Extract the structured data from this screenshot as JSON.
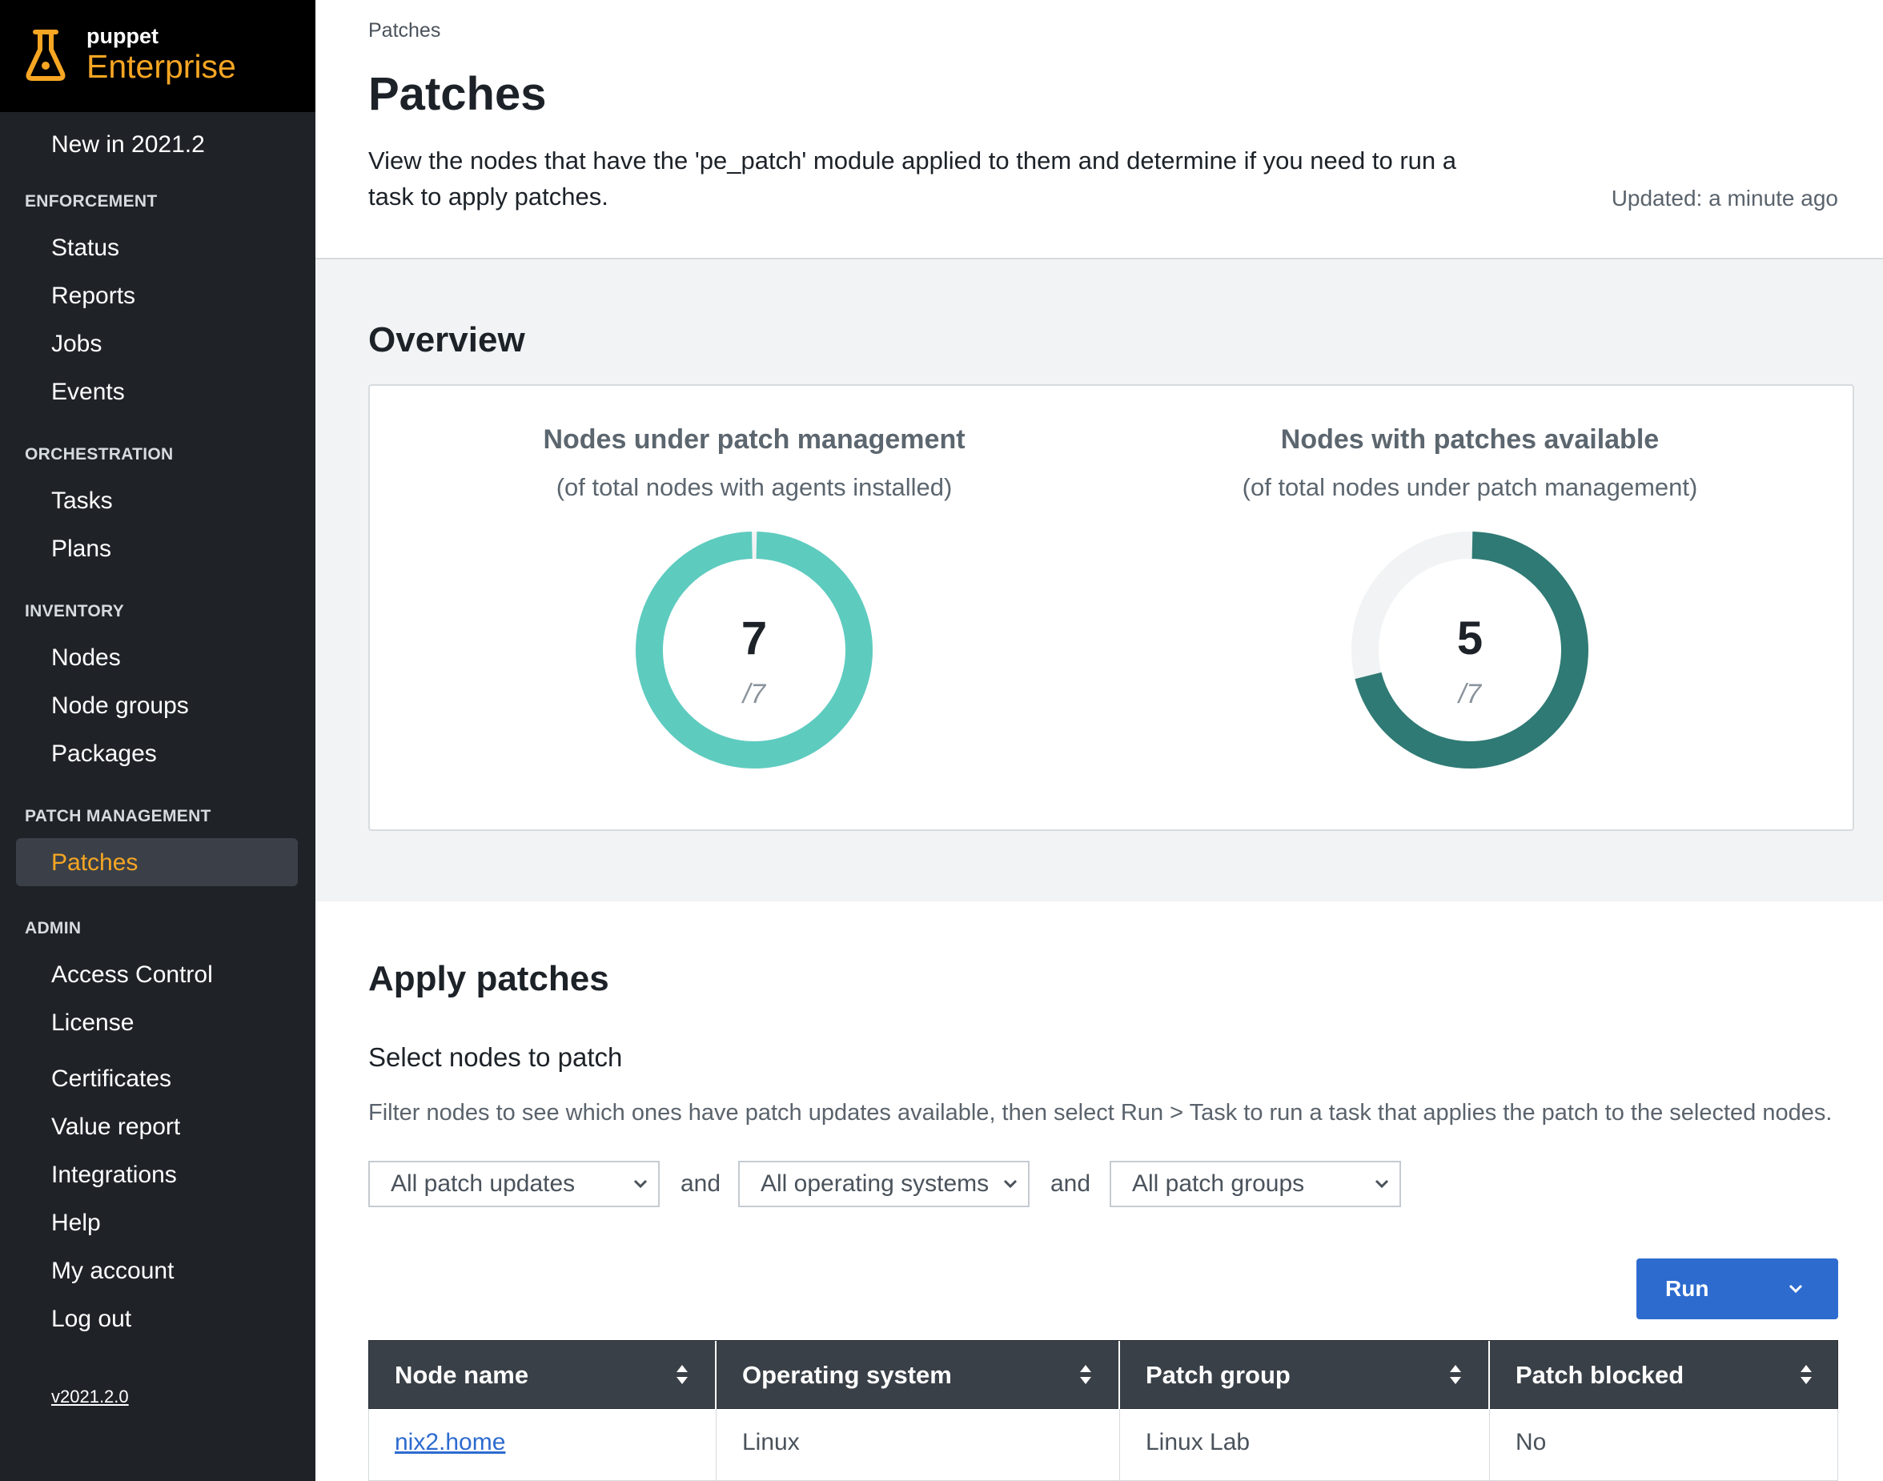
{
  "brand": {
    "name_top": "puppet",
    "name_bottom": "Enterprise",
    "accent_color": "#f6a623",
    "icon": "flask-icon"
  },
  "sidebar": {
    "new_item": "New in 2021.2",
    "sections": [
      {
        "label": "ENFORCEMENT",
        "items": [
          "Status",
          "Reports",
          "Jobs",
          "Events"
        ]
      },
      {
        "label": "ORCHESTRATION",
        "items": [
          "Tasks",
          "Plans"
        ]
      },
      {
        "label": "INVENTORY",
        "items": [
          "Nodes",
          "Node groups",
          "Packages"
        ]
      },
      {
        "label": "PATCH MANAGEMENT",
        "items": [
          "Patches"
        ]
      },
      {
        "label": "ADMIN",
        "items": [
          "Access Control",
          "License",
          "Certificates",
          "Value report",
          "Integrations",
          "Help",
          "My account",
          "Log out"
        ]
      }
    ],
    "active_item": "Patches",
    "version": "v2021.2.0"
  },
  "header": {
    "breadcrumb": "Patches",
    "title": "Patches",
    "description": "View the nodes that have the 'pe_patch' module applied to them and determine if you need to run a task to apply patches.",
    "updated": "Updated: a minute ago"
  },
  "overview": {
    "title": "Overview",
    "stats": [
      {
        "title": "Nodes under patch management",
        "subtitle": "(of total nodes with agents installed)",
        "value": "7",
        "total": "/7",
        "fraction": 1.0,
        "color": "#5ecbbf"
      },
      {
        "title": "Nodes with patches available",
        "subtitle": "(of total nodes under patch management)",
        "value": "5",
        "total": "/7",
        "fraction": 0.714,
        "color": "#2f7a74"
      }
    ]
  },
  "apply": {
    "title": "Apply patches",
    "subtitle": "Select nodes to patch",
    "description": "Filter nodes to see which ones have patch updates available, then select Run > Task to run a task that applies the patch to the selected nodes.",
    "filters": [
      "All patch updates",
      "All operating systems",
      "All patch groups"
    ],
    "conjunction": "and",
    "run_label": "Run",
    "table": {
      "columns": [
        "Node name",
        "Operating system",
        "Patch group",
        "Patch blocked"
      ],
      "rows": [
        [
          "nix2.home",
          "Linux",
          "Linux Lab",
          "No"
        ]
      ]
    }
  }
}
